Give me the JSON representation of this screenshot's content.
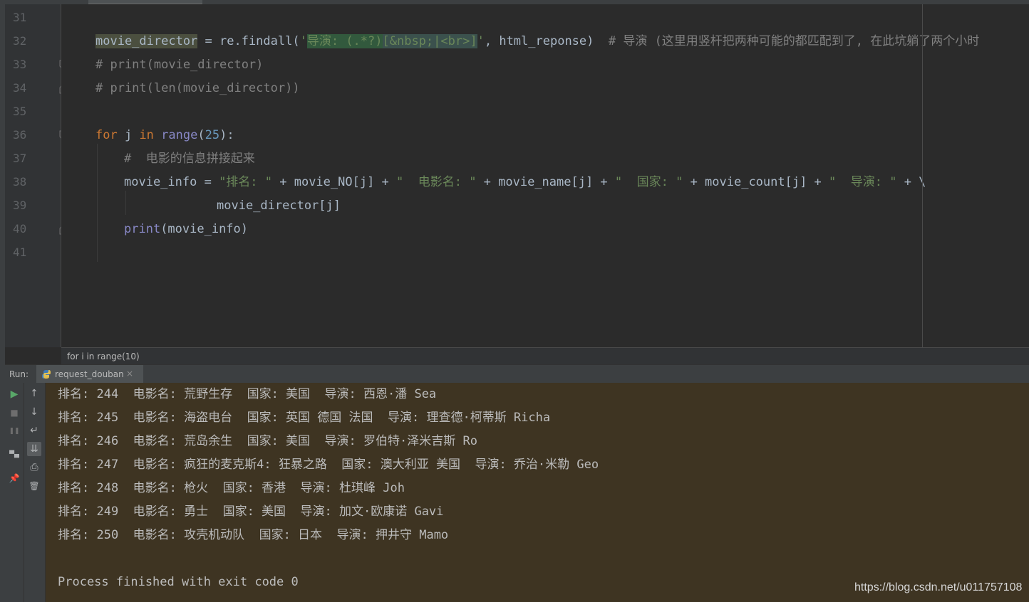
{
  "editor": {
    "line_numbers": [
      "31",
      "32",
      "33",
      "34",
      "35",
      "36",
      "37",
      "38",
      "39",
      "40",
      "41"
    ],
    "line32": {
      "var": "movie_director",
      "eq_call": " = re.findall(",
      "q_open": "'",
      "regex_a": "导演: (.*?)",
      "regex_b": "[&nbsp;",
      "regex_c": "|",
      "regex_d": "<br>",
      "regex_e": "]",
      "q_close": "'",
      "tail": ", html_reponse)  ",
      "comment": "# 导演 (这里用竖杆把两种可能的都匹配到了, 在此坑躺了两个小时"
    },
    "line33": "# print(movie_director)",
    "line34": "# print(len(movie_director))",
    "line36": {
      "kw_for": "for",
      "var": " j ",
      "kw_in": "in",
      "sp": " ",
      "fn": "range",
      "paren_open": "(",
      "num": "25",
      "paren_close": "):"
    },
    "line37": "#  电影的信息拼接起来",
    "line38": {
      "a": "movie_info = ",
      "s1": "\"排名: \"",
      "b": " + movie_NO[j] + ",
      "s2": "\"  电影名: \"",
      "c": " + movie_name[j] + ",
      "s3": "\"  国家: \"",
      "d": " + movie_count[j] + ",
      "s4": "\"  导演: \"",
      "e": " + \\"
    },
    "line39": "movie_director[j]",
    "line40": {
      "fn": "print",
      "rest": "(movie_info)"
    }
  },
  "breadcrumb": "for i in range(10)",
  "run": {
    "label": "Run:",
    "tab_name": "request_douban",
    "tab_close": "×"
  },
  "tools": {
    "rerun_icon": "▶",
    "stop_icon": "■",
    "pause_icon": "❚❚",
    "layout_icon": "▀▄",
    "pin_icon": "📌",
    "up_icon": "↑",
    "down_icon": "↓",
    "wrap_icon": "↵",
    "scroll_end_icon": "⇊",
    "print_icon": "⎙",
    "trash_icon": "🗑"
  },
  "console": {
    "lines": [
      "排名: 244  电影名: 荒野生存  国家: 美国  导演: 西恩·潘 Sea",
      "排名: 245  电影名: 海盗电台  国家: 英国 德国 法国  导演: 理查德·柯蒂斯 Richa",
      "排名: 246  电影名: 荒岛余生  国家: 美国  导演: 罗伯特·泽米吉斯 Ro",
      "排名: 247  电影名: 疯狂的麦克斯4: 狂暴之路  国家: 澳大利亚 美国  导演: 乔治·米勒 Geo",
      "排名: 248  电影名: 枪火  国家: 香港  导演: 杜琪峰 Joh",
      "排名: 249  电影名: 勇士  国家: 美国  导演: 加文·欧康诺 Gavi",
      "排名: 250  电影名: 攻壳机动队  国家: 日本  导演: 押井守 Mamo"
    ],
    "finished": "Process finished with exit code 0"
  },
  "watermark": "https://blog.csdn.net/u011757108"
}
